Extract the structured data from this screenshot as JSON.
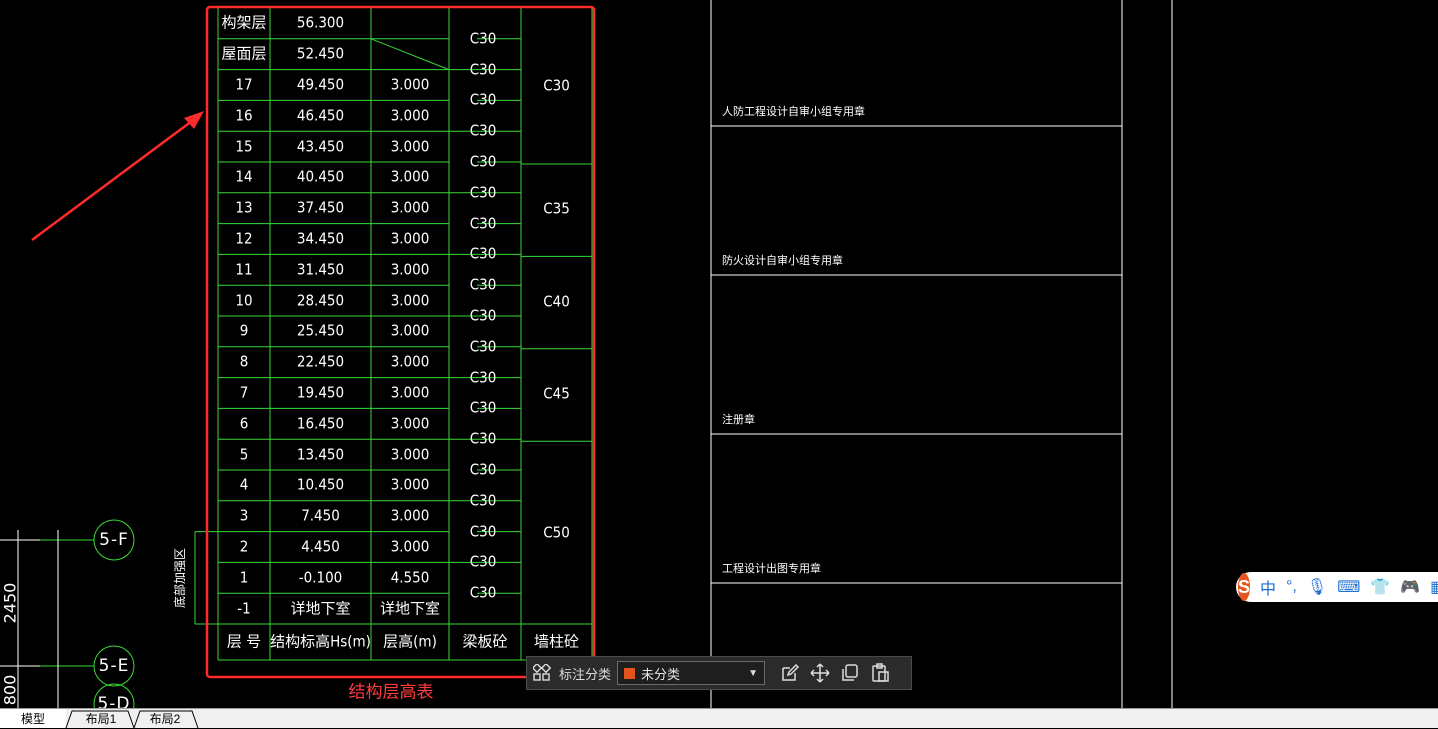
{
  "table": {
    "title": "结构层高表",
    "headers": [
      "层 号",
      "结构标高Hs(m)",
      "层高(m)",
      "梁板砼",
      "墙柱砼"
    ],
    "rows": [
      {
        "floor": "构架层",
        "elev": "56.300",
        "height": ""
      },
      {
        "floor": "屋面层",
        "elev": "52.450",
        "height": ""
      },
      {
        "floor": "17",
        "elev": "49.450",
        "height": "3.000"
      },
      {
        "floor": "16",
        "elev": "46.450",
        "height": "3.000"
      },
      {
        "floor": "15",
        "elev": "43.450",
        "height": "3.000"
      },
      {
        "floor": "14",
        "elev": "40.450",
        "height": "3.000"
      },
      {
        "floor": "13",
        "elev": "37.450",
        "height": "3.000"
      },
      {
        "floor": "12",
        "elev": "34.450",
        "height": "3.000"
      },
      {
        "floor": "11",
        "elev": "31.450",
        "height": "3.000"
      },
      {
        "floor": "10",
        "elev": "28.450",
        "height": "3.000"
      },
      {
        "floor": "9",
        "elev": "25.450",
        "height": "3.000"
      },
      {
        "floor": "8",
        "elev": "22.450",
        "height": "3.000"
      },
      {
        "floor": "7",
        "elev": "19.450",
        "height": "3.000"
      },
      {
        "floor": "6",
        "elev": "16.450",
        "height": "3.000"
      },
      {
        "floor": "5",
        "elev": "13.450",
        "height": "3.000"
      },
      {
        "floor": "4",
        "elev": "10.450",
        "height": "3.000"
      },
      {
        "floor": "3",
        "elev": "7.450",
        "height": "3.000"
      },
      {
        "floor": "2",
        "elev": "4.450",
        "height": "3.000"
      },
      {
        "floor": "1",
        "elev": "-0.100",
        "height": "4.550"
      },
      {
        "floor": "-1",
        "elev": "详地下室",
        "height": "详地下室"
      }
    ],
    "beam_concrete": [
      "C30",
      "C30",
      "C30",
      "C30",
      "C30",
      "C30",
      "C30",
      "C30",
      "C30",
      "C30",
      "C30",
      "C30",
      "C30",
      "C30",
      "C30",
      "C30",
      "C30",
      "C30",
      "C30"
    ],
    "wall_groups": [
      {
        "label": "C30"
      },
      {
        "label": "C35"
      },
      {
        "label": "C40"
      },
      {
        "label": "C45"
      },
      {
        "label": "C50"
      }
    ],
    "side_note": "底部加强区"
  },
  "stamps": [
    "人防工程设计自审小组专用章",
    "防火设计自审小组专用章",
    "注册章",
    "工程设计出图专用章"
  ],
  "grid": {
    "axis_tags": [
      "5-F",
      "5-E",
      "5-D"
    ],
    "dims": [
      "2450",
      "800"
    ]
  },
  "toolbar": {
    "label": "标注分类",
    "selected": "未分类",
    "swatch_color": "#e2541a"
  },
  "ime": {
    "logo": "S",
    "lang": "中"
  },
  "tabs": [
    "模型",
    "布局1",
    "布局2"
  ],
  "colors": {
    "table_line": "#39d939",
    "highlight": "#ff2a2a",
    "text": "#ffffff"
  }
}
